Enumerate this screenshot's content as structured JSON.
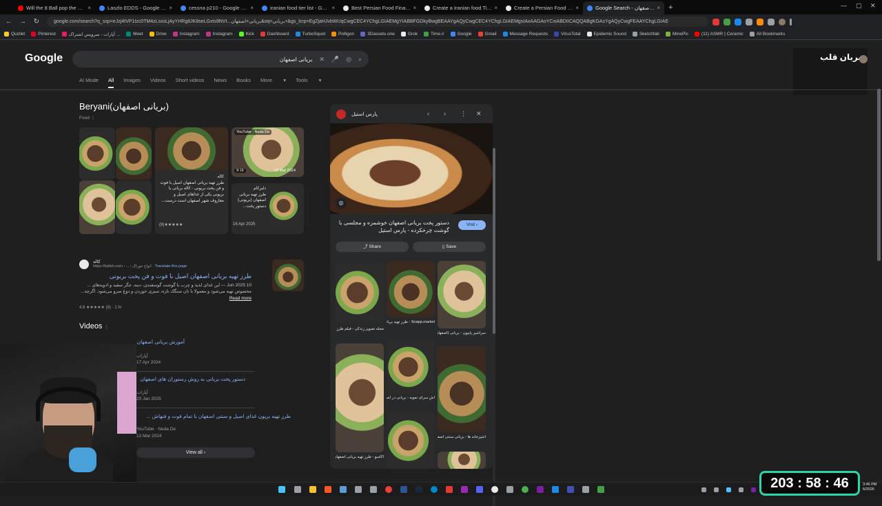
{
  "tabs": [
    {
      "label": "Will the 8 Ball pop the Corn",
      "color": "#ff0000"
    },
    {
      "label": "Laszlo EDDS - Google Search",
      "color": "#4285f4"
    },
    {
      "label": "cessna p210 - Google Search",
      "color": "#4285f4"
    },
    {
      "label": "iranian food tier list - Google Search",
      "color": "#4285f4"
    },
    {
      "label": "Best Persian Food Final Tier List",
      "color": "#e8eaed"
    },
    {
      "label": "Create a Iranian food Tier List",
      "color": "#e8eaed"
    },
    {
      "label": "Create a Persian Food Tier List",
      "color": "#e8eaed"
    },
    {
      "label": "Google Search - بریانی اصفهان",
      "color": "#4285f4"
    }
  ],
  "address": "google.com/search?q_ssp=eJzj4tVP1tzc0TM4zLsxsLjAyYHRg8JK8seLGxts9NVt...بریانی+اصفهان&oq=بریانی+&gs_lcrp=EgZjaHJvbWUqCwgCEC4YChgLGIAEMgYIABBFGDkyBwgBEAAYgAQyCwgCEC4YChgLGIAEMgsIAxAAGAoYCxiABDIICAQQABgKGAsYgAQyCwgFEAAYChgLGIAE",
  "bookmarks": [
    "Quizlet",
    "Pinterest",
    "آپارات - سرویس اشتراک ...",
    "Meet",
    "Drive",
    "Instagram",
    "Instagram",
    "Kick",
    "Dashboard",
    "TurboSquid",
    "Polligon",
    "3Dassets.one",
    "Grok",
    "Time.ir",
    "Google",
    "Gmail",
    "Message Requests",
    "VirusTotal",
    "Epidemic Sound",
    "Sketchfab",
    "MinePic",
    "(11) ASMR | Ceramic",
    "All Bookmarks"
  ],
  "logo": "Google",
  "search": {
    "value": "بریانی اصفهان"
  },
  "profile": {
    "name": "ضربان قلب"
  },
  "filters": [
    "AI Mode",
    "All",
    "Images",
    "Videos",
    "Short videos",
    "News",
    "Books",
    "More",
    "Tools"
  ],
  "kp": {
    "title": "Beryani(بریانی اصفهان)",
    "subtitle": "Food",
    "card1_src": "کاله",
    "card1_text": "طرز تهیه بریانی اصفهان اصیل با فوت و فن پخت بریونی - کاله بریانی یا بریونی یکی از غذاهای اصیل و معاروف شهر اصفهان است درست...",
    "card1_rating": "(8)★★★★★",
    "yt_badge": "YouTube · Neda De",
    "yt_dur": "9:16",
    "yt_date": "13 Mar 2024",
    "card3_src": "دلیرکام",
    "card3_text": "طرز تهیه بریانی اصفهان (بریونی) دستور پخت...",
    "card3_date": "16 Apr 2025"
  },
  "result": {
    "site": "کاله",
    "url": "https://kalleh.com › ... › انواع خوراک",
    "translate": "Translate this page",
    "title": "طرز تهیه بریانی اصفهان اصیل با فوت و فن پخت بریونی",
    "date": "10 Jun 2025 —",
    "snippet": "این غذای لذیذ و چرب با گوشت گوسفندی، دنبه، جگر سفید و ادویه‌های ... مخصوص تهیه می‌شود و معمولا با نان سنگک تازه، سبزی خوردن و دوغ سرو می‌شود. اگرچه...",
    "more": "Read more",
    "rating": "4.8 ★★★★★ (8) · 1 hr"
  },
  "videos": {
    "heading": "Videos",
    "items": [
      {
        "title": "آموزش بریانی اصفهان",
        "src": "آپارات",
        "date": "17 Apr 2024"
      },
      {
        "title": "دستور پخت بریانی به روش رستوران های اصفهان",
        "src": "آپارات",
        "date": "20 Jan 2025"
      },
      {
        "title": "طرز تهیه بریون غذای اصیل و سنتی اصفهان با تمام فوت و فنهاش ...",
        "src": "YouTube · Neda De",
        "date": "13 Mar 2024"
      }
    ],
    "view_all": "View all"
  },
  "panel": {
    "site": "پارس استیل",
    "title": "دستور پخت بریانی اصفهان خوشمزه و مجلسی با گوشت چرخکرده - پارس استیل",
    "visit": "Visit",
    "share": "Share",
    "save": "Save",
    "captions": [
      "مجله تصویر زندگی - فیلم طرز تهیه بریانی",
      "Snapp.market - طرز تهیه بریانی اصفهان",
      "سرآشپز پاپیون - بریانی (اصفهان)",
      "آش سرای نمونه - بریانی در اصفهان | بریانی",
      "اشپزخانه ها - بریانی سنتی اصفهان قدیم",
      "اکاسو - طرز تهیه بریانی اصفهان"
    ]
  },
  "timer": "203 : 58 : 46",
  "clock": {
    "time": "3:46 PM",
    "date": "6/2026"
  }
}
